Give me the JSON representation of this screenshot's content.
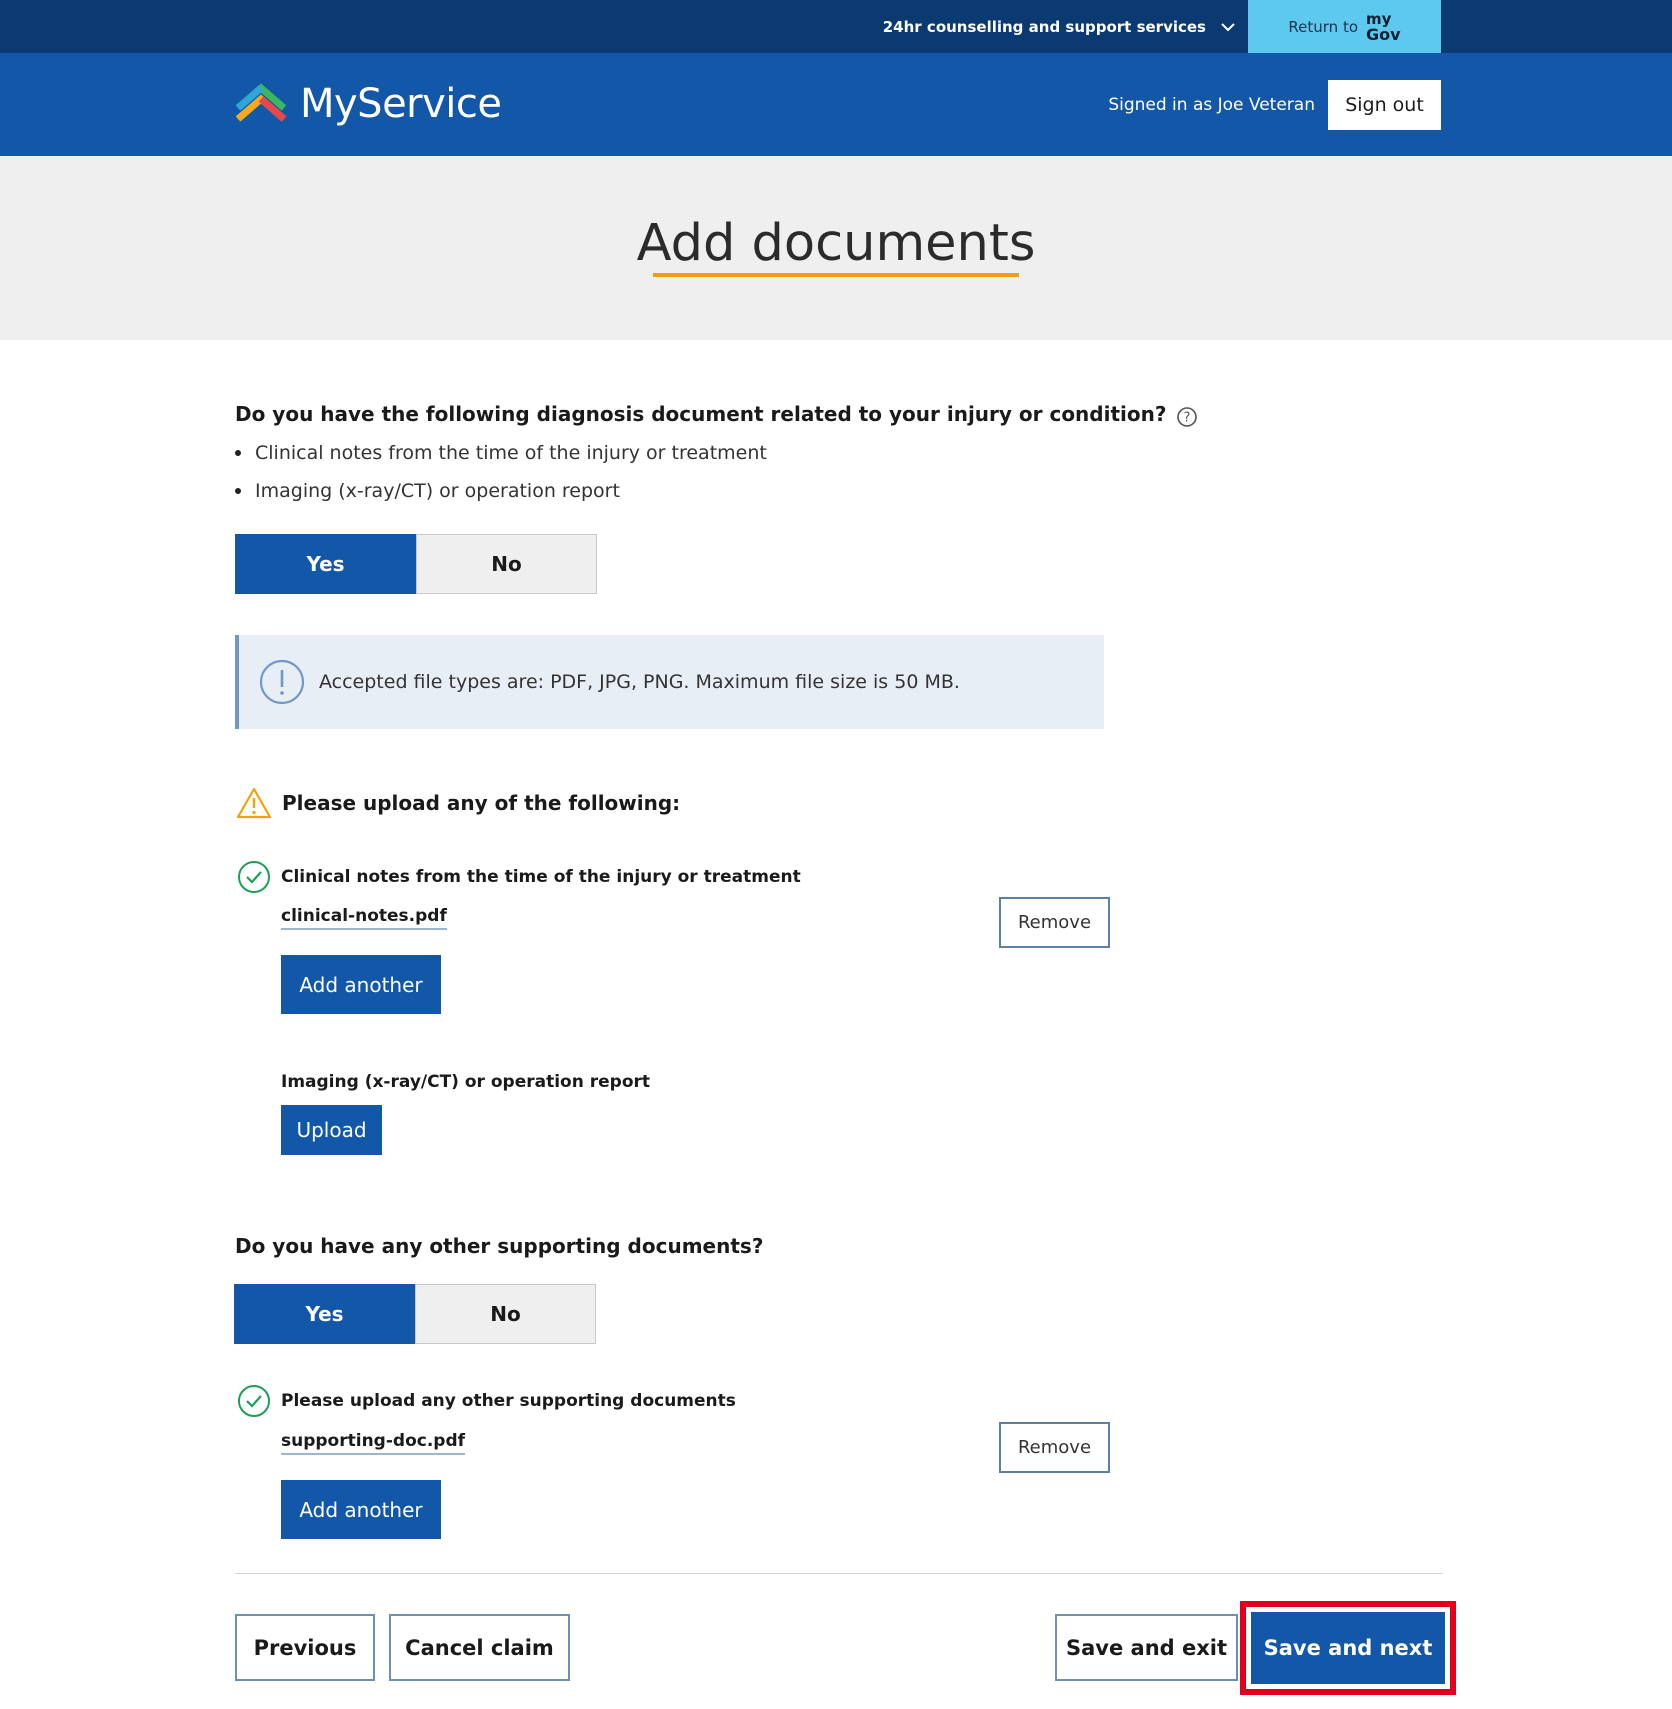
{
  "utility_bar": {
    "support_label": "24hr counselling and support services",
    "return_label": "Return to",
    "mygov_top": "my",
    "mygov_bottom": "Gov"
  },
  "header": {
    "brand": "MyService",
    "signed_in_text": "Signed in as Joe Veteran",
    "sign_out_label": "Sign out"
  },
  "page": {
    "title": "Add documents"
  },
  "diagnosis_question": {
    "heading": "Do you have the following diagnosis document related to your injury or condition?",
    "bullets": [
      "Clinical notes from the time of the injury or treatment",
      "Imaging (x-ray/CT) or operation report"
    ],
    "yes_label": "Yes",
    "no_label": "No",
    "selected": "Yes"
  },
  "info_notice": {
    "text": "Accepted file types are: PDF, JPG, PNG. Maximum file size is 50 MB."
  },
  "upload_section": {
    "heading": "Please upload any of the following:",
    "items": [
      {
        "label": "Clinical notes from the time of the injury or treatment",
        "file": "clinical-notes.pdf",
        "remove_label": "Remove",
        "add_label": "Add another"
      },
      {
        "label": "Imaging (x-ray/CT) or operation report",
        "upload_label": "Upload"
      }
    ]
  },
  "supporting_question": {
    "heading": "Do you have any other supporting documents?",
    "yes_label": "Yes",
    "no_label": "No",
    "selected": "Yes",
    "upload_label": "Please upload any other supporting documents",
    "file": "supporting-doc.pdf",
    "remove_label": "Remove",
    "add_label": "Add another"
  },
  "footer_actions": {
    "previous_label": "Previous",
    "cancel_label": "Cancel claim",
    "save_exit_label": "Save and exit",
    "save_next_label": "Save and next"
  },
  "colors": {
    "primary": "#1257a8",
    "top_bar": "#0b3a73",
    "accent_underline": "#f39c12",
    "highlight": "#e0001b",
    "success": "#1e9e55",
    "warning": "#f0a30a"
  },
  "icons": {
    "support_chevron": "chevron-down-icon",
    "help": "question-circle-icon",
    "info": "exclamation-circle-icon",
    "warning": "warning-triangle-icon",
    "complete": "check-circle-icon"
  }
}
